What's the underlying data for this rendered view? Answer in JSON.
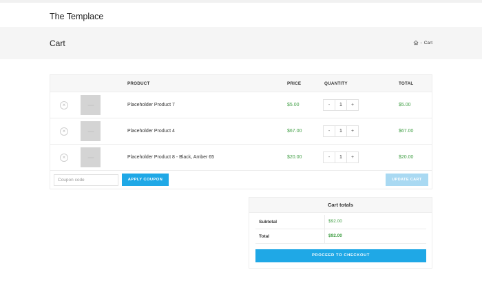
{
  "site": {
    "title": "The Templace"
  },
  "page": {
    "title": "Cart",
    "breadcrumb_current": "Cart",
    "breadcrumb_separator": "›"
  },
  "cart": {
    "headers": {
      "product": "PRODUCT",
      "price": "PRICE",
      "quantity": "QUANTITY",
      "total": "TOTAL"
    },
    "items": [
      {
        "name": "Placeholder Product 7",
        "price": "$5.00",
        "quantity": "1",
        "total": "$5.00"
      },
      {
        "name": "Placeholder Product 4",
        "price": "$67.00",
        "quantity": "1",
        "total": "$67.00"
      },
      {
        "name": "Placeholder Product 8 - Black, Amber 65",
        "price": "$20.00",
        "quantity": "1",
        "total": "$20.00"
      }
    ],
    "remove_symbol": "×",
    "qty_minus": "-",
    "qty_plus": "+",
    "coupon_placeholder": "Coupon code",
    "apply_coupon_label": "APPLY COUPON",
    "update_cart_label": "UPDATE CART"
  },
  "totals": {
    "title": "Cart totals",
    "subtotal_label": "Subtotal",
    "subtotal_value": "$92.00",
    "total_label": "Total",
    "total_value": "$92.00",
    "checkout_label": "PROCEED TO CHECKOUT"
  },
  "icons": {
    "breadcrumb_home": "home-icon",
    "remove_item": "close-circle-icon",
    "product_image": "image-placeholder-icon"
  },
  "colors": {
    "accent": "#1fa8e6",
    "accent_disabled": "#a9d9f2",
    "price": "#43a047",
    "hero_bg": "#f5f5f5"
  }
}
